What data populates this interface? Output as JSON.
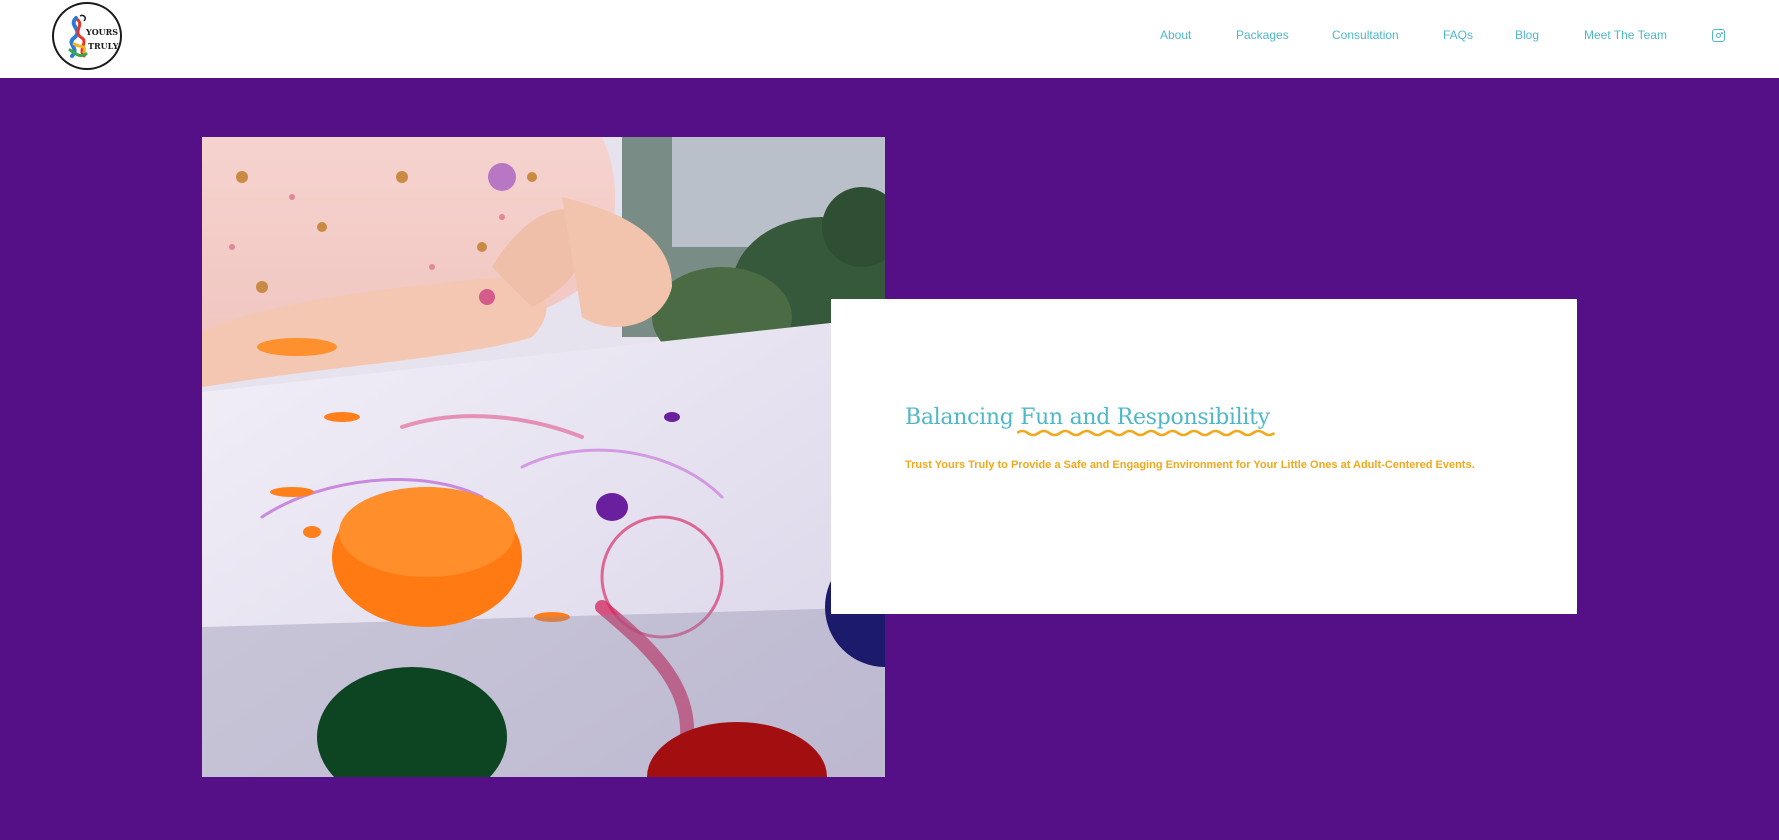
{
  "brand": {
    "logo_line1": "YOURS",
    "logo_line2": "TRULY"
  },
  "nav": {
    "items": [
      {
        "label": "About"
      },
      {
        "label": "Packages"
      },
      {
        "label": "Consultation"
      },
      {
        "label": "FAQs"
      },
      {
        "label": "Blog"
      },
      {
        "label": "Meet The Team"
      }
    ],
    "social_icon": "instagram-icon"
  },
  "hero": {
    "title_plain": "Balancing ",
    "title_highlight": "Fun and Responsibility",
    "subtitle": "Trust Yours Truly to Provide a Safe and Engaging Environment for Your Little Ones at Adult-Centered Events."
  },
  "colors": {
    "background": "#561087",
    "accent_teal": "#4fb8c8",
    "accent_gold": "#f0a81d",
    "card": "#ffffff"
  }
}
